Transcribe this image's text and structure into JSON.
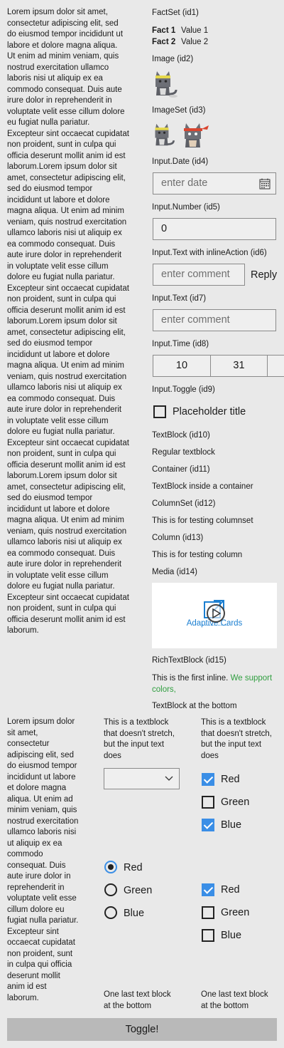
{
  "left_lorem": "Lorem ipsum dolor sit amet,\nconsectetur adipiscing elit, sed\ndo eiusmod tempor incididunt ut\nlabore et dolore magna aliqua.\nUt enim ad minim veniam, quis\nnostrud exercitation ullamco\nlaboris nisi ut aliquip ex ea\ncommodo consequat. Duis aute\nirure dolor in reprehenderit in\nvoluptate velit esse cillum dolore\neu fugiat nulla pariatur.\nExcepteur sint occaecat cupidatat\nnon proident, sunt in culpa qui\nofficia deserunt mollit anim id est\nlaborum.Lorem ipsum dolor sit\namet, consectetur adipiscing elit,\nsed do eiusmod tempor\nincididunt ut labore et dolore\nmagna aliqua. Ut enim ad minim\nveniam, quis nostrud exercitation\nullamco laboris nisi ut aliquip ex\nea commodo consequat. Duis\naute irure dolor in reprehenderit\nin voluptate velit esse cillum\ndolore eu fugiat nulla pariatur.\nExcepteur sint occaecat cupidatat\nnon proident, sunt in culpa qui\nofficia deserunt mollit anim id est\nlaborum.Lorem ipsum dolor sit\namet, consectetur adipiscing elit,\nsed do eiusmod tempor\nincididunt ut labore et dolore\nmagna aliqua. Ut enim ad minim\nveniam, quis nostrud exercitation\nullamco laboris nisi ut aliquip ex\nea commodo consequat. Duis\naute irure dolor in reprehenderit\nin voluptate velit esse cillum\ndolore eu fugiat nulla pariatur.\nExcepteur sint occaecat cupidatat\nnon proident, sunt in culpa qui\nofficia deserunt mollit anim id est\nlaborum.Lorem ipsum dolor sit\namet, consectetur adipiscing elit,\nsed do eiusmod tempor\nincididunt ut labore et dolore\nmagna aliqua. Ut enim ad minim\nveniam, quis nostrud exercitation\nullamco laboris nisi ut aliquip ex\nea commodo consequat. Duis\naute irure dolor in reprehenderit\nin voluptate velit esse cillum\ndolore eu fugiat nulla pariatur.\nExcepteur sint occaecat cupidatat\nnon proident, sunt in culpa qui\nofficia deserunt mollit anim id est\nlaborum.",
  "factset": {
    "label": "FactSet (id1)",
    "facts": [
      {
        "title": "Fact 1",
        "value": "Value 1"
      },
      {
        "title": "Fact 2",
        "value": "Value 2"
      }
    ]
  },
  "image": {
    "label": "Image (id2)"
  },
  "imageset": {
    "label": "ImageSet (id3)"
  },
  "input_date": {
    "label": "Input.Date (id4)",
    "placeholder": "enter date",
    "icon": "calendar-icon"
  },
  "input_number": {
    "label": "Input.Number (id5)",
    "value": "0"
  },
  "input_text_inline": {
    "label": "Input.Text with inlineAction (id6)",
    "placeholder": "enter comment",
    "action": "Reply"
  },
  "input_text": {
    "label": "Input.Text (id7)",
    "placeholder": "enter comment"
  },
  "input_time": {
    "label": "Input.Time (id8)",
    "hour": "10",
    "minute": "31"
  },
  "input_toggle": {
    "label": "Input.Toggle (id9)",
    "title": "Placeholder title"
  },
  "textblock": {
    "label": "TextBlock (id10)",
    "text": "Regular textblock"
  },
  "container": {
    "label": "Container (id11)",
    "text": "TextBlock inside a container"
  },
  "columnset": {
    "label": "ColumnSet (id12)",
    "text": "This is for testing columnset"
  },
  "column": {
    "label": "Column (id13)",
    "text": "This is for testing column"
  },
  "media": {
    "label": "Media (id14)",
    "poster_text": "Adaptive Cards",
    "play_icon": "play-icon"
  },
  "richtext": {
    "label": "RichTextBlock (id15)",
    "inline1": "This is the first inline. ",
    "inline2": "We support colors,",
    "inline2_color": "#2f9e3f"
  },
  "bottom_textblock": "TextBlock at the bottom",
  "bottom_lorem": "Lorem ipsum dolor\nsit amet,\nconsectetur\nadipiscing elit, sed\ndo eiusmod tempor\nincididunt ut labore\net dolore magna\naliqua. Ut enim ad\nminim veniam, quis\nnostrud exercitation\nullamco laboris nisi\nut aliquip ex ea\ncommodo\nconsequat. Duis\naute irure dolor in\nreprehenderit in\nvoluptate velit esse\ncillum dolore eu\nfugiat nulla pariatur.\nExcepteur sint\noccaecat cupidatat\nnon proident, sunt\nin culpa qui officia\ndeserunt mollit\nanim id est\nlaborum.",
  "mid_col": {
    "heading": "This is a textblock\nthat doesn't stretch,\nbut the input text\ndoes",
    "radios": [
      {
        "label": "Red",
        "checked": true
      },
      {
        "label": "Green",
        "checked": false
      },
      {
        "label": "Blue",
        "checked": false
      }
    ],
    "bottom": "One last text block\nat the bottom"
  },
  "right_col": {
    "heading": "This is a textblock\nthat doesn't stretch,\nbut the input text\ndoes",
    "checks1": [
      {
        "label": "Red",
        "checked": true
      },
      {
        "label": "Green",
        "checked": false
      },
      {
        "label": "Blue",
        "checked": true
      }
    ],
    "checks2": [
      {
        "label": "Red",
        "checked": true
      },
      {
        "label": "Green",
        "checked": false
      },
      {
        "label": "Blue",
        "checked": false
      }
    ],
    "bottom": "One last text block\nat the bottom"
  },
  "toggle_button": "Toggle!",
  "colors": {
    "accent": "#3a8ee6",
    "background": "#e9e9e9",
    "button": "#b9b9b9"
  }
}
